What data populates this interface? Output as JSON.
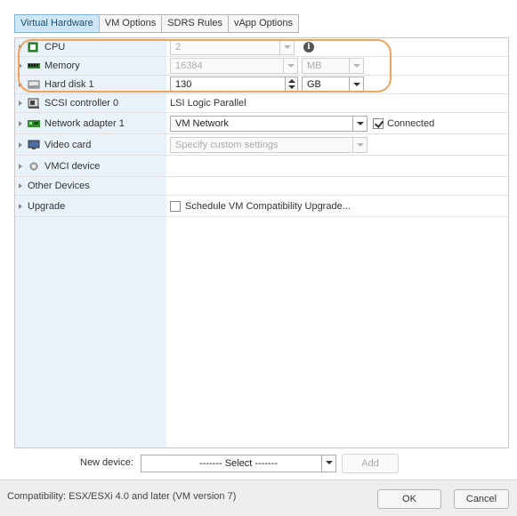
{
  "tabs": [
    "Virtual Hardware",
    "VM Options",
    "SDRS Rules",
    "vApp Options"
  ],
  "rows": {
    "cpu": {
      "label": "CPU",
      "value": "2"
    },
    "memory": {
      "label": "Memory",
      "value": "16384",
      "unit": "MB"
    },
    "hard_disk": {
      "label": "Hard disk 1",
      "value": "130",
      "unit": "GB"
    },
    "scsi": {
      "label": "SCSI controller 0",
      "value": "LSI Logic Parallel"
    },
    "network": {
      "label": "Network adapter 1",
      "value": "VM Network",
      "connected_label": "Connected",
      "connected": true
    },
    "video": {
      "label": "Video card",
      "value": "Specify custom settings"
    },
    "vmci": {
      "label": "VMCI device"
    },
    "other": {
      "label": "Other Devices"
    },
    "upgrade": {
      "label": "Upgrade",
      "value": "Schedule VM Compatibility Upgrade..."
    }
  },
  "new_device": {
    "label": "New device:",
    "select": "------- Select -------",
    "add": "Add"
  },
  "footer": {
    "compatibility": "Compatibility: ESX/ESXi 4.0 and later (VM version 7)",
    "ok": "OK",
    "cancel": "Cancel"
  },
  "colors": {
    "active_tab": "#cfe6f7",
    "left_column": "#e9f2f9",
    "highlight": "#f0a35a"
  },
  "icons": [
    "cpu-icon",
    "memory-icon",
    "hard-disk-icon",
    "scsi-controller-icon",
    "network-adapter-icon",
    "video-card-icon",
    "vmci-device-icon",
    "info-icon"
  ]
}
